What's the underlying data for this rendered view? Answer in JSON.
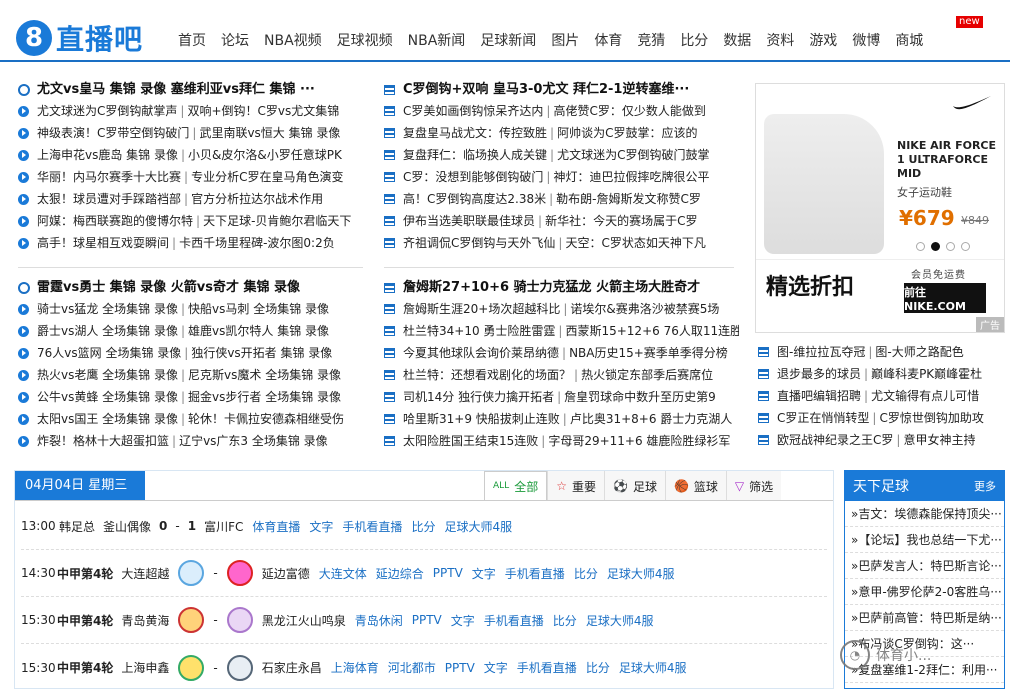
{
  "site": {
    "logo_digit": "8",
    "logo_text": "直播吧"
  },
  "nav": {
    "items": [
      "首页",
      "论坛",
      "NBA视频",
      "足球视频",
      "NBA新闻",
      "足球新闻",
      "图片",
      "体育",
      "竞猜",
      "比分",
      "数据",
      "资料",
      "游戏",
      "微博",
      "商城"
    ],
    "new_badge": "new"
  },
  "block1": {
    "title": "尤文vs皇马 集锦 录像 塞维利亚vs拜仁 集锦 ···",
    "rows": [
      [
        "尤文球迷为C罗倒钩献掌声",
        "双响+倒钩！C罗vs尤文集锦"
      ],
      [
        "神级表演！C罗带空倒钩破门",
        "武里南联vs恒大 集锦 录像"
      ],
      [
        "上海申花vs鹿岛 集锦 录像",
        "小贝&皮尔洛&小罗任意球PK"
      ],
      [
        "华丽！内马尔赛季十大比赛",
        "专业分析C罗在皇马角色演变"
      ],
      [
        "太狠！球员遭对手踩踏裆部",
        "官方分析拉达尔战术作用"
      ],
      [
        "阿媒：梅西联赛跑的傻博尔特",
        "天下足球-贝肯鲍尔君临天下"
      ],
      [
        "高手！球星相互戏耍瞬间",
        "卡西千场里程碑-波尔图0:2负"
      ]
    ]
  },
  "block2": {
    "title": "C罗倒钩+双响 皇马3-0尤文 拜仁2-1逆转塞维···",
    "rows": [
      [
        "C罗美如画倒钩惊呆齐达内",
        "高佬赞C罗：仅少数人能做到"
      ],
      [
        "复盘皇马战尤文：传控致胜",
        "阿帅谈为C罗鼓掌：应该的"
      ],
      [
        "复盘拜仁：临场换人成关键",
        "尤文球迷为C罗倒钩破门鼓掌"
      ],
      [
        "C罗：没想到能够倒钩破门",
        "神灯：迪巴拉假摔吃牌很公平"
      ],
      [
        "高！C罗倒钩高度达2.38米",
        "勒布朗-詹姆斯发文称赞C罗"
      ],
      [
        "伊布当选美职联最佳球员",
        "新华社：今天的赛场属于C罗"
      ],
      [
        "齐祖调侃C罗倒钩与天外飞仙",
        "天空：C罗状态如天神下凡"
      ]
    ]
  },
  "block3": {
    "title": "雷霆vs勇士 集锦 录像 火箭vs奇才 集锦 录像",
    "rows": [
      [
        "骑士vs猛龙 全场集锦 录像",
        "快船vs马刺 全场集锦 录像"
      ],
      [
        "爵士vs湖人 全场集锦 录像",
        "雄鹿vs凯尔特人 集锦 录像"
      ],
      [
        "76人vs篮网 全场集锦 录像",
        "独行侠vs开拓者 集锦 录像"
      ],
      [
        "热火vs老鹰 全场集锦 录像",
        "尼克斯vs魔术 全场集锦 录像"
      ],
      [
        "公牛vs黄蜂 全场集锦 录像",
        "掘金vs步行者 全场集锦 录像"
      ],
      [
        "太阳vs国王 全场集锦 录像",
        "轮休！卡佩拉安德森相继受伤"
      ],
      [
        "炸裂！格林十大超蛋扣篮",
        "辽宁vs广东3 全场集锦 录像"
      ]
    ]
  },
  "block4": {
    "title": "詹姆斯27+10+6 骑士力克猛龙 火箭主场大胜奇才",
    "rows": [
      [
        "詹姆斯生涯20+场次超越科比",
        "诺埃尔&赛弗洛沙被禁赛5场"
      ],
      [
        "杜兰特34+10 勇士险胜雷霆",
        "西蒙斯15+12+6 76人取11连胜"
      ],
      [
        "今夏其他球队会询价莱昂纳德",
        "NBA历史15+赛季单季得分榜"
      ],
      [
        "杜兰特：还想看戏剧化的场面？",
        "热火锁定东部季后赛席位"
      ],
      [
        "司机14分 独行侠力擒开拓者",
        "詹皇罚球命中数升至历史第9"
      ],
      [
        "哈里斯31+9 快船拔刺止连败",
        "卢比奥31+8+6 爵士力克湖人"
      ],
      [
        "太阳险胜国王结束15连败",
        "字母哥29+11+6 雄鹿险胜绿衫军"
      ]
    ]
  },
  "ad": {
    "product": "NIKE AIR FORCE 1 ULTRAFORCE MID",
    "subtitle": "女子运动鞋",
    "price": "¥679",
    "old_price": "¥849",
    "headline": "精选折扣",
    "free_shipping": "会员免运费",
    "cta": "前往 NIKE.COM",
    "tag": "广告"
  },
  "right_links": [
    [
      "图-维拉拉瓦夺冠",
      "图-大师之路配色"
    ],
    [
      "退步最多的球员",
      "巅峰科麦PK巅峰霍杜"
    ],
    [
      "直播吧编辑招聘",
      "尤文输得有点儿可惜"
    ],
    [
      "C罗正在悄悄转型",
      "C罗惊世倒钩加助攻"
    ],
    [
      "欧冠战神纪录之王C罗",
      "意甲女神主持"
    ]
  ],
  "schedule": {
    "date": "04月04日 星期三",
    "tabs": [
      {
        "icon": "ALL",
        "label": "全部"
      },
      {
        "icon": "☆",
        "label": "重要"
      },
      {
        "icon": "⚽",
        "label": "足球"
      },
      {
        "icon": "🏀",
        "label": "篮球"
      },
      {
        "icon": "▽",
        "label": "筛选"
      }
    ],
    "matches": [
      {
        "time": "13:00",
        "league": "韩足总",
        "home": "釜山偶像",
        "score_home": "0",
        "score_sep": "-",
        "score_away": "1",
        "away": "富川FC",
        "links": [
          "体育直播",
          "文字",
          "手机看直播",
          "比分",
          "足球大师4服"
        ]
      },
      {
        "time": "14:30",
        "league": "中甲第4轮",
        "home": "大连超越",
        "sep": "-",
        "away": "延边富德",
        "links": [
          "大连文体",
          "延边综合",
          "PPTV",
          "文字",
          "手机看直播",
          "比分",
          "足球大师4服"
        ]
      },
      {
        "time": "15:30",
        "league": "中甲第4轮",
        "home": "青岛黄海",
        "sep": "-",
        "away": "黑龙江火山鸣泉",
        "links": [
          "青岛休闲",
          "PPTV",
          "文字",
          "手机看直播",
          "比分",
          "足球大师4服"
        ]
      },
      {
        "time": "15:30",
        "league": "中甲第4轮",
        "home": "上海申鑫",
        "sep": "-",
        "away": "石家庄永昌",
        "links": [
          "上海体育",
          "河北都市",
          "PPTV",
          "文字",
          "手机看直播",
          "比分",
          "足球大师4服"
        ]
      }
    ]
  },
  "side": {
    "title": "天下足球",
    "more": "更多",
    "items": [
      "»吉文：埃德森能保持顶尖···",
      "»【论坛】我也总结一下尤···",
      "»巴萨发言人：特巴斯言论···",
      "»意甲-佛罗伦萨2-0客胜乌···",
      "»巴萨前高管：特巴斯是纳···",
      "»布冯谈C罗倒钩：这···",
      "»复盘塞维1-2拜仁：利用···"
    ]
  },
  "watermark": "体育小..."
}
